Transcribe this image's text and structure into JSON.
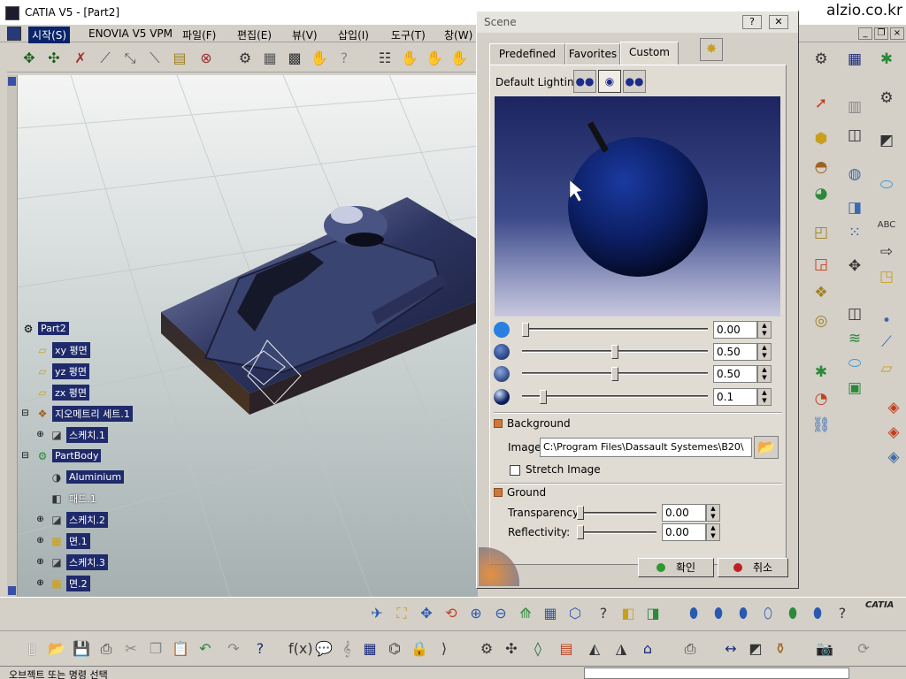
{
  "window": {
    "title": "CATIA V5 - [Part2]",
    "watermark": "alzio.co.kr"
  },
  "menu": {
    "items": [
      {
        "label": "시작(S)",
        "active": true
      },
      {
        "label": "ENOVIA V5 VPM"
      },
      {
        "label": "파일(F)"
      },
      {
        "label": "편집(E)"
      },
      {
        "label": "뷰(V)"
      },
      {
        "label": "삽입(I)"
      },
      {
        "label": "도구(T)"
      },
      {
        "label": "창(W)"
      }
    ]
  },
  "tree": {
    "root": "Part2",
    "nodes": [
      {
        "label": "xy 평면"
      },
      {
        "label": "yz 평면"
      },
      {
        "label": "zx 평면"
      },
      {
        "label": "지오메트리 세트.1"
      },
      {
        "label": "스케치.1"
      },
      {
        "label": "PartBody"
      },
      {
        "label": "Aluminium"
      },
      {
        "label": "패드.1"
      },
      {
        "label": "스케치.2"
      },
      {
        "label": "면.1"
      },
      {
        "label": "스케치.3"
      },
      {
        "label": "면.2"
      }
    ]
  },
  "dialog": {
    "title": "Scene",
    "help_btn": "?",
    "close_btn": "✕",
    "tabs": [
      {
        "label": "Predefined"
      },
      {
        "label": "Favorites"
      },
      {
        "label": "Custom",
        "active": true
      }
    ],
    "default_lighting_label": "Default Lighting:",
    "sliders": [
      {
        "value": "0.00",
        "level": 0.0
      },
      {
        "value": "0.50",
        "level": 0.5
      },
      {
        "value": "0.50",
        "level": 0.5
      },
      {
        "value": "0.1",
        "level": 0.1
      }
    ],
    "background": {
      "header": "Background",
      "image_label": "Image:",
      "image_path": "C:\\Program Files\\Dassault Systemes\\B20\\",
      "stretch_label": "Stretch Image",
      "stretch_checked": false
    },
    "ground": {
      "header": "Ground",
      "transparency_label": "Transparency:",
      "transparency_value": "0.00",
      "transparency_level": 0.0,
      "reflectivity_label": "Reflectivity:",
      "reflectivity_value": "0.00",
      "reflectivity_level": 0.0
    },
    "ok_label": "확인",
    "cancel_label": "취소"
  },
  "status": {
    "text": "오브젝트 또는 명령 선택"
  },
  "logo": "CATIA",
  "colors": {
    "tree_highlight": "#1f2a6b",
    "ok_dot": "#2e9a2e",
    "cancel_dot": "#c02020",
    "section_mark": "#d0783a"
  }
}
